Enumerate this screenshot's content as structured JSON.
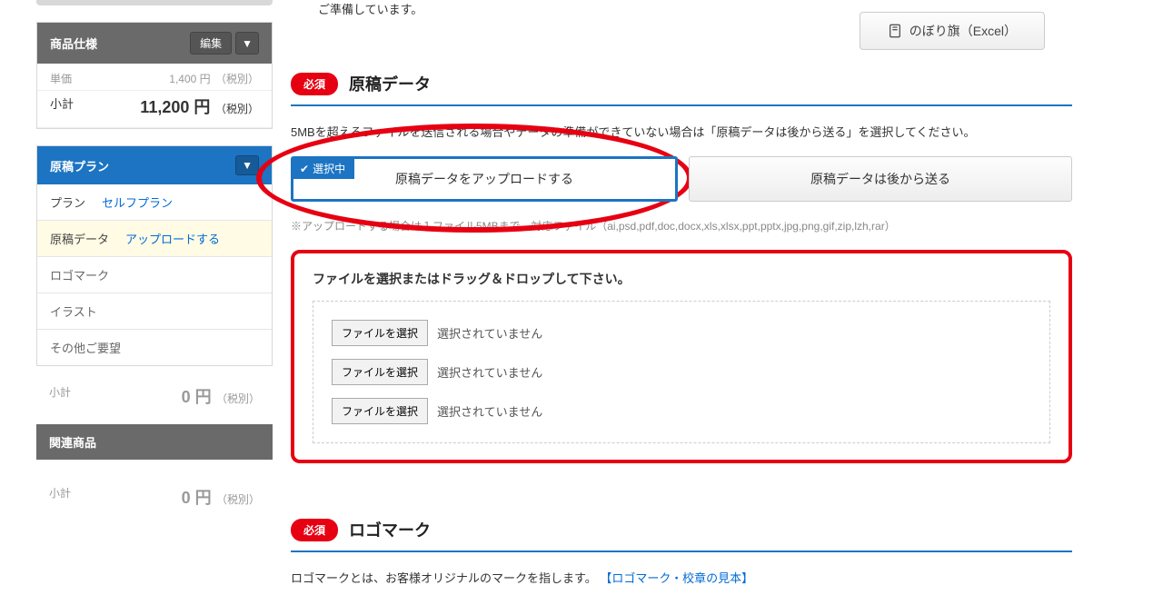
{
  "sidebar": {
    "spec": {
      "title": "商品仕様",
      "edit_label": "編集",
      "unit_price_label": "単価",
      "unit_price": "1,400 円",
      "subtotal_label": "小計",
      "subtotal": "11,200 円",
      "tax_label": "（税別）"
    },
    "plan": {
      "title": "原稿プラン",
      "items": [
        {
          "label": "プラン",
          "value": "セルフプラン"
        },
        {
          "label": "原稿データ",
          "value": "アップロードする"
        },
        {
          "label": "ロゴマーク"
        },
        {
          "label": "イラスト"
        },
        {
          "label": "その他ご要望"
        }
      ],
      "subtotal_label": "小計",
      "subtotal": "0 円",
      "tax_label": "（税別）"
    },
    "related": {
      "title": "関連商品",
      "subtotal_label": "小計",
      "subtotal": "0 円",
      "tax_label": "（税別）"
    }
  },
  "main": {
    "intro": "ご準備しています。",
    "download_btn": "のぼり旗（Excel）",
    "section1": {
      "badge": "必須",
      "title": "原稿データ",
      "desc": "5MBを超えるファイルを送信される場合やデータの準備ができていない場合は「原稿データは後から送る」を選択してください。",
      "choice_selected_tab": "選択中",
      "choice_upload": "原稿データをアップロードする",
      "choice_later": "原稿データは後から送る",
      "note": "※アップロードする場合は１ファイル5MBまで。対応ファイル（ai,psd,pdf,doc,docx,xls,xlsx,ppt,pptx,jpg,png,gif,zip,lzh,rar）",
      "upload_title": "ファイルを選択またはドラッグ＆ドロップして下さい。",
      "file_btn": "ファイルを選択",
      "file_status": "選択されていません"
    },
    "section2": {
      "badge": "必須",
      "title": "ロゴマーク",
      "desc_prefix": "ロゴマークとは、お客様オリジナルのマークを指します。",
      "desc_link": "【ロゴマーク・校章の見本】"
    }
  }
}
